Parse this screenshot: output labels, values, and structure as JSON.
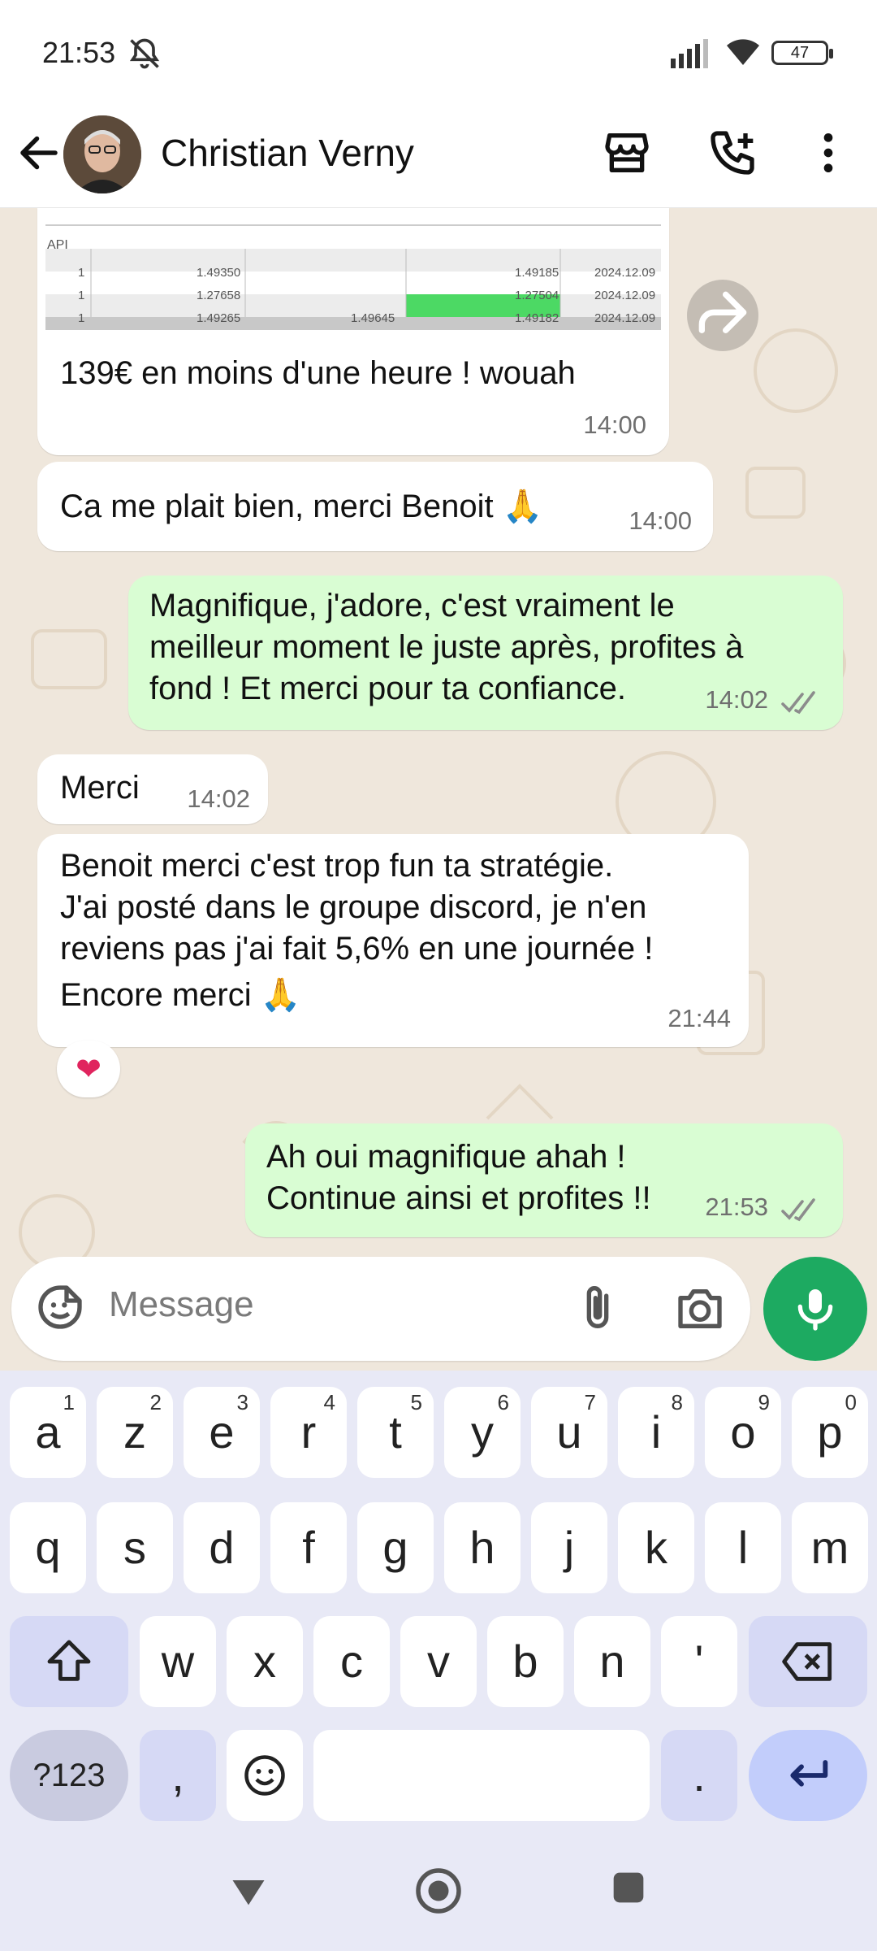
{
  "status_bar": {
    "time": "21:53",
    "battery": "47"
  },
  "header": {
    "contact_name": "Christian Verny"
  },
  "screenshot_table": {
    "label": "API",
    "rows": [
      [
        "1",
        "1.49350",
        "",
        "1.49185",
        "2024.12.09"
      ],
      [
        "1",
        "1.27658",
        "",
        "1.27504",
        "2024.12.09"
      ],
      [
        "1",
        "1.49265",
        "1.49645",
        "1.49182",
        "2024.12.09"
      ]
    ]
  },
  "messages": [
    {
      "id": "m1",
      "dir": "in",
      "text": "139€ en moins d'une heure ! wouah",
      "time": "14:00"
    },
    {
      "id": "m2",
      "dir": "in",
      "text": "Ca me plait bien, merci Benoit 🙏",
      "time": "14:00"
    },
    {
      "id": "m3",
      "dir": "out",
      "lines": [
        "Magnifique, j'adore, c'est vraiment le",
        "meilleur moment le juste après, profites à",
        "fond ! Et merci pour ta confiance."
      ],
      "time": "14:02"
    },
    {
      "id": "m4",
      "dir": "in",
      "text": "Merci",
      "time": "14:02"
    },
    {
      "id": "m5",
      "dir": "in",
      "lines": [
        "Benoit merci c'est trop fun ta stratégie.",
        "J'ai posté dans le groupe discord, je n'en",
        "reviens pas j'ai fait 5,6% en une journée !",
        "Encore merci 🙏"
      ],
      "time": "21:44",
      "reaction": "❤"
    },
    {
      "id": "m6",
      "dir": "out",
      "lines": [
        "Ah oui magnifique ahah !",
        "Continue ainsi et profites !!"
      ],
      "time": "21:53"
    }
  ],
  "composer": {
    "placeholder": "Message"
  },
  "keyboard": {
    "row1": [
      [
        "a",
        "1"
      ],
      [
        "z",
        "2"
      ],
      [
        "e",
        "3"
      ],
      [
        "r",
        "4"
      ],
      [
        "t",
        "5"
      ],
      [
        "y",
        "6"
      ],
      [
        "u",
        "7"
      ],
      [
        "i",
        "8"
      ],
      [
        "o",
        "9"
      ],
      [
        "p",
        "0"
      ]
    ],
    "row2": [
      "q",
      "s",
      "d",
      "f",
      "g",
      "h",
      "j",
      "k",
      "l",
      "m"
    ],
    "row3": [
      "w",
      "x",
      "c",
      "v",
      "b",
      "n",
      "'"
    ],
    "sym_label": "?123",
    "comma": ",",
    "period": "."
  },
  "colors": {
    "accent": "#1daa61",
    "outgoing_bubble": "#d9fdd3",
    "wallpaper": "#efe7dc"
  }
}
